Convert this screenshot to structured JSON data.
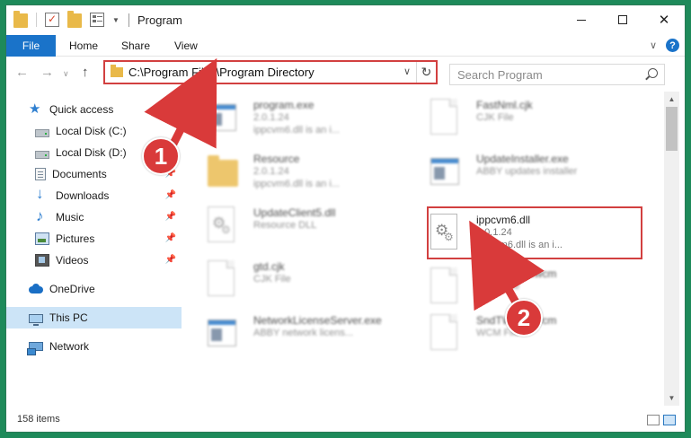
{
  "window": {
    "title": "Program"
  },
  "ribbon": {
    "file_tab": "File",
    "tabs": [
      "Home",
      "Share",
      "View"
    ]
  },
  "address": {
    "path": "C:\\Program Files\\Program Directory"
  },
  "search": {
    "placeholder": "Search Program"
  },
  "nav": {
    "items": [
      {
        "label": "Quick access",
        "icon": "star-icon",
        "pinned": false
      },
      {
        "label": "Local Disk (C:)",
        "icon": "drive-icon",
        "pinned": false
      },
      {
        "label": "Local Disk (D:)",
        "icon": "drive-icon",
        "pinned": false
      },
      {
        "label": "Documents",
        "icon": "documents-icon",
        "pinned": true
      },
      {
        "label": "Downloads",
        "icon": "downloads-icon",
        "pinned": true
      },
      {
        "label": "Music",
        "icon": "music-icon",
        "pinned": true
      },
      {
        "label": "Pictures",
        "icon": "pictures-icon",
        "pinned": true
      },
      {
        "label": "Videos",
        "icon": "videos-icon",
        "pinned": true
      },
      {
        "label": "OneDrive",
        "icon": "onedrive-icon",
        "pinned": false
      },
      {
        "label": "This PC",
        "icon": "pc-icon",
        "pinned": false,
        "selected": true
      },
      {
        "label": "Network",
        "icon": "network-icon",
        "pinned": false
      }
    ]
  },
  "files": [
    {
      "name": "program.exe",
      "sub": "2.0.1.24",
      "desc": "ippcvm6.dll is an i...",
      "icon": "exe-icon",
      "blurred": true
    },
    {
      "name": "FastNml.cjk",
      "sub": "CJK File",
      "desc": "",
      "icon": "file-icon",
      "blurred": true
    },
    {
      "name": "Resource",
      "sub": "2.0.1.24",
      "desc": "ippcvm6.dll is an i...",
      "icon": "folder-icon",
      "blurred": true
    },
    {
      "name": "UpdateInstaller.exe",
      "sub": "ABBY updates installer",
      "desc": "",
      "icon": "exe-icon",
      "blurred": true
    },
    {
      "name": "UpdateClient5.dll",
      "sub": "Resource DLL",
      "desc": "",
      "icon": "dll-icon",
      "blurred": true
    },
    {
      "name": "ippcvm6.dll",
      "sub": "2.0.1.24",
      "desc": "ippcvm6.dll is an i...",
      "icon": "dll-icon",
      "blurred": false
    },
    {
      "name": "gtd.cjk",
      "sub": "CJK File",
      "desc": "",
      "icon": "file-icon",
      "blurred": true
    },
    {
      "name": "SndTWP16.wcm",
      "sub": "WCM File",
      "desc": "",
      "icon": "file-icon",
      "blurred": true
    },
    {
      "name": "NetworkLicenseServer.exe",
      "sub": "ABBY network licens...",
      "desc": "",
      "icon": "exe-icon",
      "blurred": true
    },
    {
      "name": "SndTWP16.wcm",
      "sub": "WCM File",
      "desc": "",
      "icon": "file-icon",
      "blurred": true
    }
  ],
  "status": {
    "item_count": "158 items"
  },
  "steps": [
    "1",
    "2"
  ],
  "colors": {
    "accent": "#1a73c9",
    "highlight": "#d24040",
    "selected": "#cce4f7",
    "desktop": "#1e8a5a"
  }
}
